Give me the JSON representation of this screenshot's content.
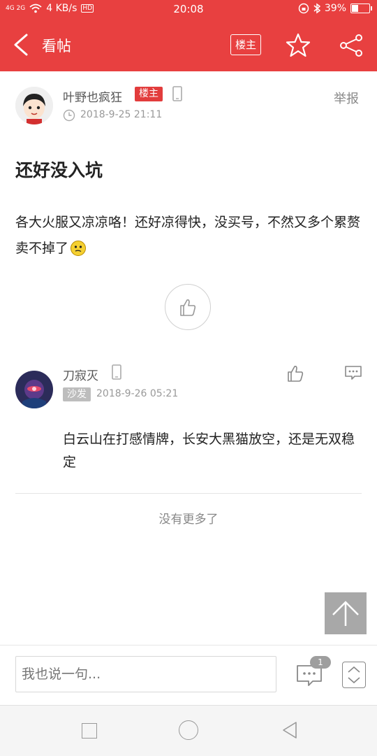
{
  "status": {
    "network": "4G 2G",
    "speed": "4 KB/s",
    "hd": "HD",
    "time": "20:08",
    "battery": "39%",
    "battery_level": 0.39
  },
  "header": {
    "title": "看帖",
    "lz_button": "楼主",
    "icons": [
      "back-arrow-icon",
      "star-icon",
      "share-icon"
    ]
  },
  "post": {
    "author": "叶野也疯狂",
    "badge": "楼主",
    "report": "举报",
    "time": "2018-9-25 21:11",
    "title": "还好没入坑",
    "body": "各大火服又凉凉咯！还好凉得快，没买号，不然又多个累赘卖不掉了"
  },
  "reply": {
    "author": "刀寂灭",
    "badge": "沙发",
    "time": "2018-9-26 05:21",
    "body": "白云山在打感情牌，长安大黑猫放空，还是无双稳定"
  },
  "footer": {
    "no_more": "没有更多了",
    "comment_placeholder": "我也说一句...",
    "comment_count": "1"
  },
  "colors": {
    "brand": "#e84040",
    "badge_lz": "#e23c3c",
    "badge_sofa": "#bdbdbd"
  }
}
